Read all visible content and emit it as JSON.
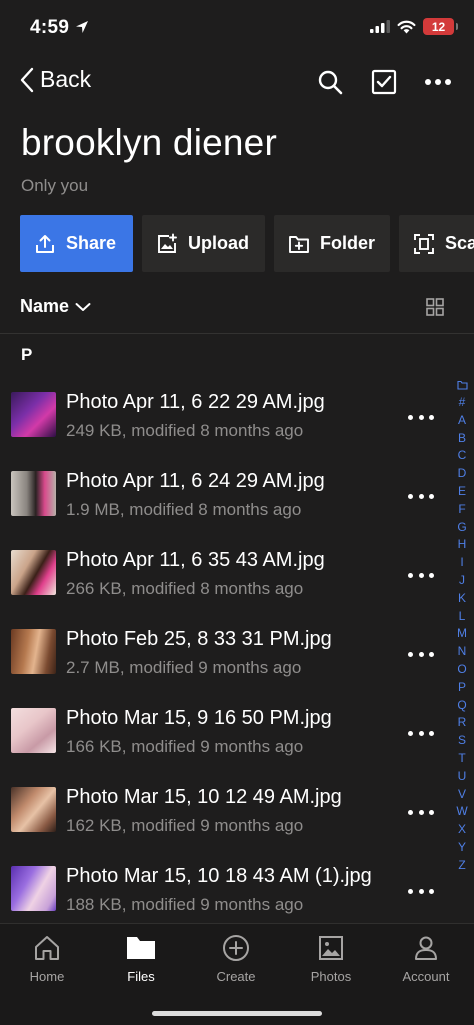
{
  "status_bar": {
    "time": "4:59",
    "battery": "12"
  },
  "nav": {
    "back_label": "Back"
  },
  "folder": {
    "title": "brooklyn diener",
    "sharing": "Only you"
  },
  "actions": [
    {
      "label": "Share"
    },
    {
      "label": "Upload"
    },
    {
      "label": "Folder"
    },
    {
      "label": "Sca"
    }
  ],
  "sort": {
    "label": "Name"
  },
  "section_letter": "P",
  "files": [
    {
      "name": "Photo Apr 11, 6 22 29 AM.jpg",
      "meta": "249 KB, modified 8 months ago"
    },
    {
      "name": "Photo Apr 11, 6 24 29 AM.jpg",
      "meta": "1.9 MB, modified 8 months ago"
    },
    {
      "name": "Photo Apr 11, 6 35 43 AM.jpg",
      "meta": "266 KB, modified 8 months ago"
    },
    {
      "name": "Photo Feb 25, 8 33 31 PM.jpg",
      "meta": "2.7 MB, modified 9 months ago"
    },
    {
      "name": "Photo Mar 15, 9 16 50 PM.jpg",
      "meta": "166 KB, modified 9 months ago"
    },
    {
      "name": "Photo Mar 15, 10 12 49 AM.jpg",
      "meta": "162 KB, modified 9 months ago"
    },
    {
      "name": "Photo Mar 15, 10 18 43 AM (1).jpg",
      "meta": "188 KB, modified 9 months ago"
    }
  ],
  "alpha_index": [
    "#",
    "A",
    "B",
    "C",
    "D",
    "E",
    "F",
    "G",
    "H",
    "I",
    "J",
    "K",
    "L",
    "M",
    "N",
    "O",
    "P",
    "Q",
    "R",
    "S",
    "T",
    "U",
    "V",
    "W",
    "X",
    "Y",
    "Z"
  ],
  "tabs": [
    {
      "label": "Home",
      "icon": "home-icon"
    },
    {
      "label": "Files",
      "icon": "files-icon"
    },
    {
      "label": "Create",
      "icon": "create-icon"
    },
    {
      "label": "Photos",
      "icon": "photos-icon"
    },
    {
      "label": "Account",
      "icon": "account-icon"
    }
  ],
  "colors": {
    "accent": "#3b76e6",
    "index": "#4f7fe6",
    "background": "#1e1d1d"
  }
}
